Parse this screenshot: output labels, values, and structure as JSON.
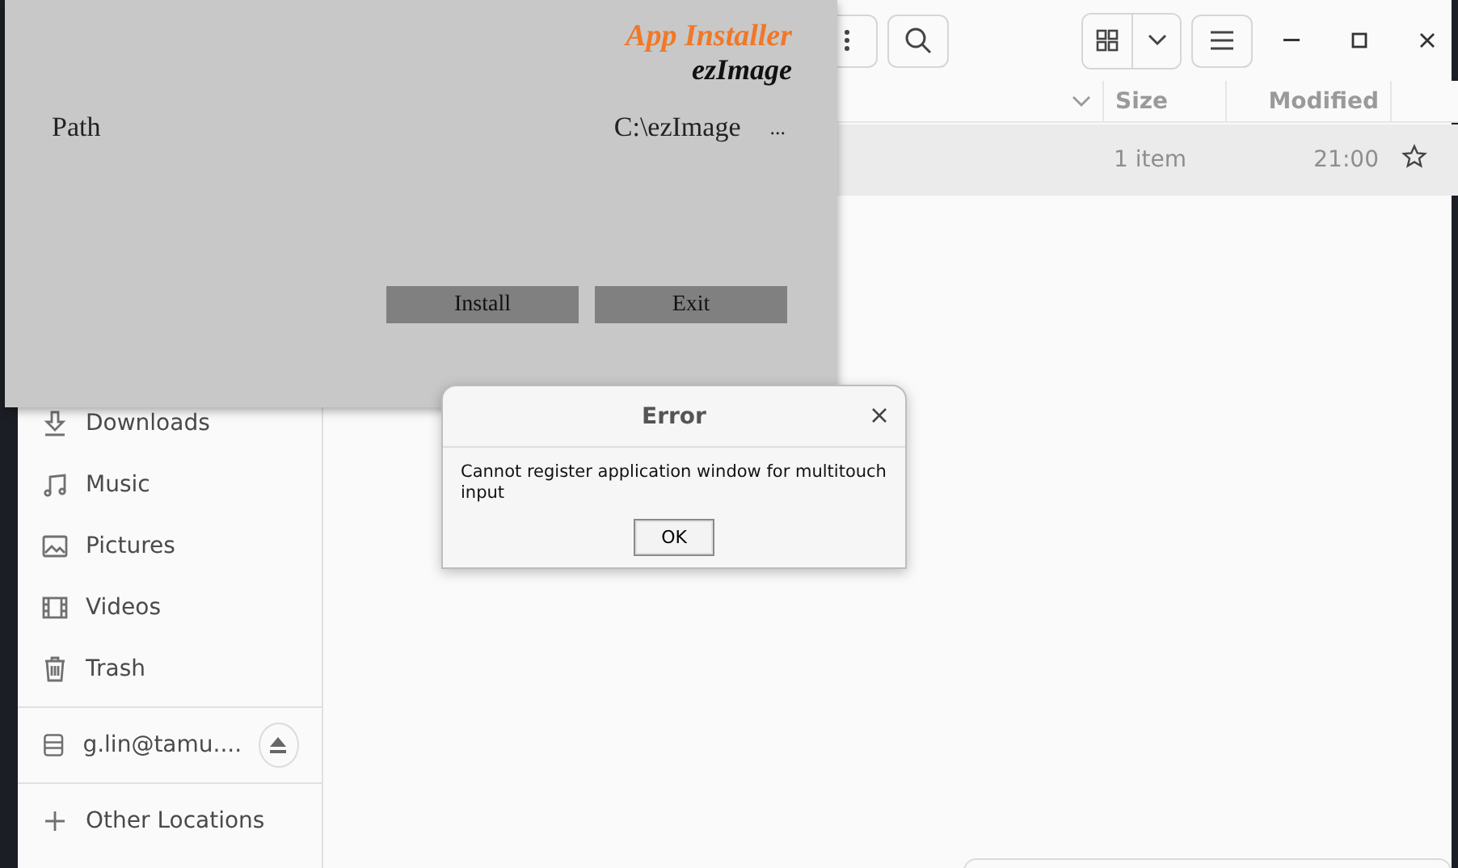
{
  "file_manager": {
    "columns": [
      {
        "label": "Size"
      },
      {
        "label": "Modified"
      }
    ],
    "rows": [
      {
        "size": "1 item",
        "modified": "21:00",
        "selected": true,
        "starred": false
      }
    ],
    "sidebar": {
      "items": [
        {
          "kind": "downloads",
          "label": "Downloads"
        },
        {
          "kind": "music",
          "label": "Music"
        },
        {
          "kind": "pictures",
          "label": "Pictures"
        },
        {
          "kind": "videos",
          "label": "Videos"
        },
        {
          "kind": "trash",
          "label": "Trash"
        },
        {
          "kind": "mount",
          "label": "g.lin@tamu...."
        },
        {
          "kind": "other",
          "label": "Other Locations"
        }
      ]
    }
  },
  "installer": {
    "title": "App Installer",
    "subtitle": "ezImage",
    "path_label": "Path",
    "path_value": "C:\\ezImage",
    "browse_button": "...",
    "buttons": [
      "Install",
      "Exit"
    ]
  },
  "error_dialog": {
    "title": "Error",
    "message": "Cannot register application window for multitouch input",
    "button": "OK"
  }
}
